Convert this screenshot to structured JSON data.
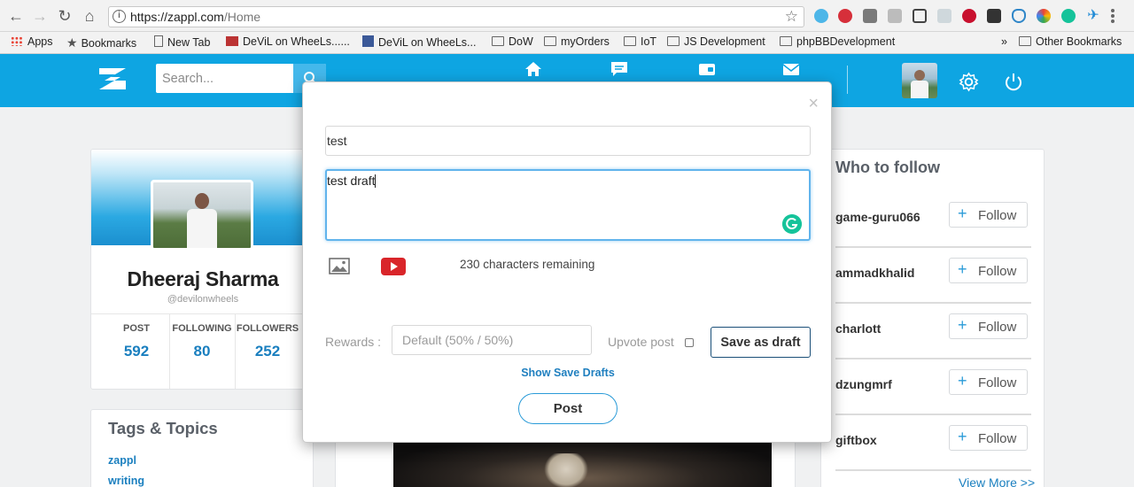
{
  "browser": {
    "url_host": "https://zappl.com",
    "url_path": "/Home"
  },
  "bookmarks": [
    {
      "label": "Apps",
      "icon": "apps-grid-icon"
    },
    {
      "label": "Bookmarks",
      "icon": "star-icon"
    },
    {
      "label": "New Tab",
      "icon": "page-icon"
    },
    {
      "label": "DeViL on WheeLs......",
      "icon": "site-favicon"
    },
    {
      "label": "DeViL on WheeLs...",
      "icon": "facebook-icon"
    },
    {
      "label": "DoW",
      "icon": "folder-icon"
    },
    {
      "label": "myOrders",
      "icon": "folder-icon"
    },
    {
      "label": "IoT",
      "icon": "folder-icon"
    },
    {
      "label": "JS Development",
      "icon": "folder-icon"
    },
    {
      "label": "phpBBDevelopment",
      "icon": "folder-icon"
    }
  ],
  "bookmarks_overflow": "»",
  "other_bookmarks": "Other Bookmarks",
  "header": {
    "search_placeholder": "Search..."
  },
  "profile": {
    "name": "Dheeraj Sharma",
    "handle": "@devilonwheels",
    "stats": [
      {
        "label": "POST",
        "value": "592"
      },
      {
        "label": "FOLLOWING",
        "value": "80"
      },
      {
        "label": "FOLLOWERS",
        "value": "252"
      }
    ]
  },
  "tags": {
    "title": "Tags & Topics",
    "items": [
      "zappl",
      "writing"
    ]
  },
  "who_to_follow": {
    "title": "Who to follow",
    "button_label": "Follow",
    "users": [
      "game-guru066",
      "ammadkhalid",
      "charlott",
      "dzungmrf",
      "giftbox"
    ],
    "view_more": "View More >>"
  },
  "modal": {
    "close": "×",
    "title_value": "test",
    "body_value": "test draft",
    "char_remaining": "230 characters remaining",
    "rewards_label": "Rewards :",
    "rewards_placeholder": "Default (50% / 50%)",
    "upvote_label": "Upvote post",
    "save_draft_label": "Save as draft",
    "show_drafts_label": "Show Save Drafts",
    "post_label": "Post"
  },
  "colors": {
    "header_blue": "#0ea5e2",
    "link_blue": "#1a7fbf",
    "focus_border": "#61b4ec"
  }
}
